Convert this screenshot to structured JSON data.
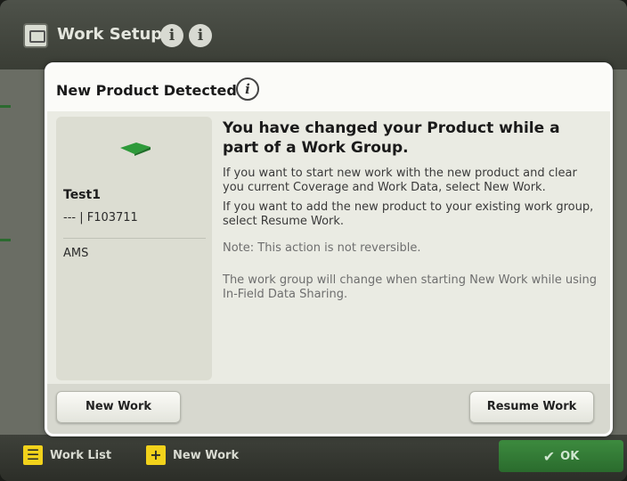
{
  "app": {
    "title": "Work Setup",
    "info1": "i",
    "info2": "i"
  },
  "bottom_bar": {
    "work_list_label": "Work List",
    "new_work_label": "New Work",
    "new_work_icon": "+",
    "ok_label": "OK"
  },
  "modal": {
    "title": "New Product Detected",
    "info": "i",
    "product": {
      "name": "Test1",
      "id": "--- | F103711",
      "type": "AMS"
    },
    "heading": "You have changed your Product while a part of a Work Group.",
    "paragraph1": "If you want to start new work with the new product and clear you current Coverage and Work Data, select New Work.",
    "paragraph2": "If you want to add the new product to your existing work group, select Resume Work.",
    "note": "Note: This action is not reversible.",
    "paragraph3": "The work group will change when starting New Work while using In-Field Data Sharing.",
    "new_work_button": "New Work",
    "resume_work_button": "Resume Work"
  },
  "colors": {
    "accent_green": "#3d8b3f",
    "icon_yellow": "#f2d21b",
    "product_green": "#2e9a3a"
  }
}
